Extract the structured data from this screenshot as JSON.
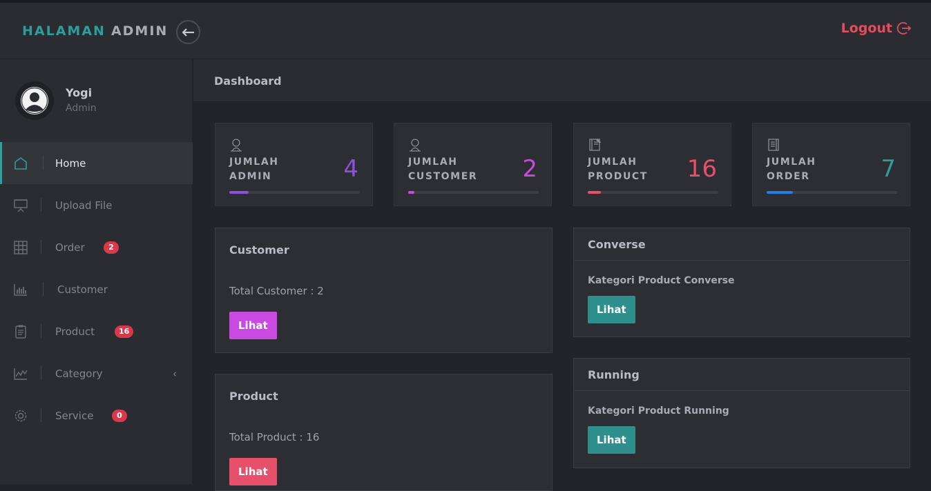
{
  "header": {
    "brand_part1": "HALAMAN",
    "brand_part2": "ADMIN",
    "logout_label": "Logout"
  },
  "profile": {
    "name": "Yogi",
    "role": "Admin"
  },
  "sidebar": {
    "items": [
      {
        "label": "Home",
        "icon": "home-icon",
        "active": true
      },
      {
        "label": "Upload File",
        "icon": "presentation-icon"
      },
      {
        "label": "Order",
        "icon": "grid-icon",
        "badge": "2"
      },
      {
        "label": "Customer",
        "icon": "bar-chart-icon"
      },
      {
        "label": "Product",
        "icon": "clipboard-icon",
        "badge": "16"
      },
      {
        "label": "Category",
        "icon": "line-chart-icon",
        "has_submenu": true
      },
      {
        "label": "Service",
        "icon": "gear-icon",
        "badge": "0"
      }
    ]
  },
  "page": {
    "title": "Dashboard"
  },
  "stats": [
    {
      "label_line1": "JUMLAH",
      "label_line2": "ADMIN",
      "value": "4",
      "color": "#8e4fdb",
      "progress": 0.15,
      "icon": "user-icon"
    },
    {
      "label_line1": "JUMLAH",
      "label_line2": "CUSTOMER",
      "value": "2",
      "color": "#c84ae0",
      "progress": 0.05,
      "icon": "user-icon"
    },
    {
      "label_line1": "JUMLAH",
      "label_line2": "PRODUCT",
      "value": "16",
      "color": "#e6506a",
      "progress": 0.1,
      "icon": "notebook-icon"
    },
    {
      "label_line1": "JUMLAH",
      "label_line2": "ORDER",
      "value": "7",
      "color": "#2e9e9a",
      "progress": 0.2,
      "bar_color": "#1f7fe8",
      "icon": "document-icon"
    }
  ],
  "cards": {
    "customer": {
      "title": "Customer",
      "text": "Total Customer : 2",
      "button": "Lihat",
      "button_color": "#c84ae0"
    },
    "product": {
      "title": "Product",
      "text": "Total Product : 16",
      "button": "Lihat",
      "button_color": "#e6506a"
    },
    "converse": {
      "title": "Converse",
      "subtitle": "Kategori Product Converse",
      "button": "Lihat",
      "button_color": "#2e8f8c"
    },
    "running": {
      "title": "Running",
      "subtitle": "Kategori Product Running",
      "button": "Lihat",
      "button_color": "#2e8f8c"
    }
  }
}
